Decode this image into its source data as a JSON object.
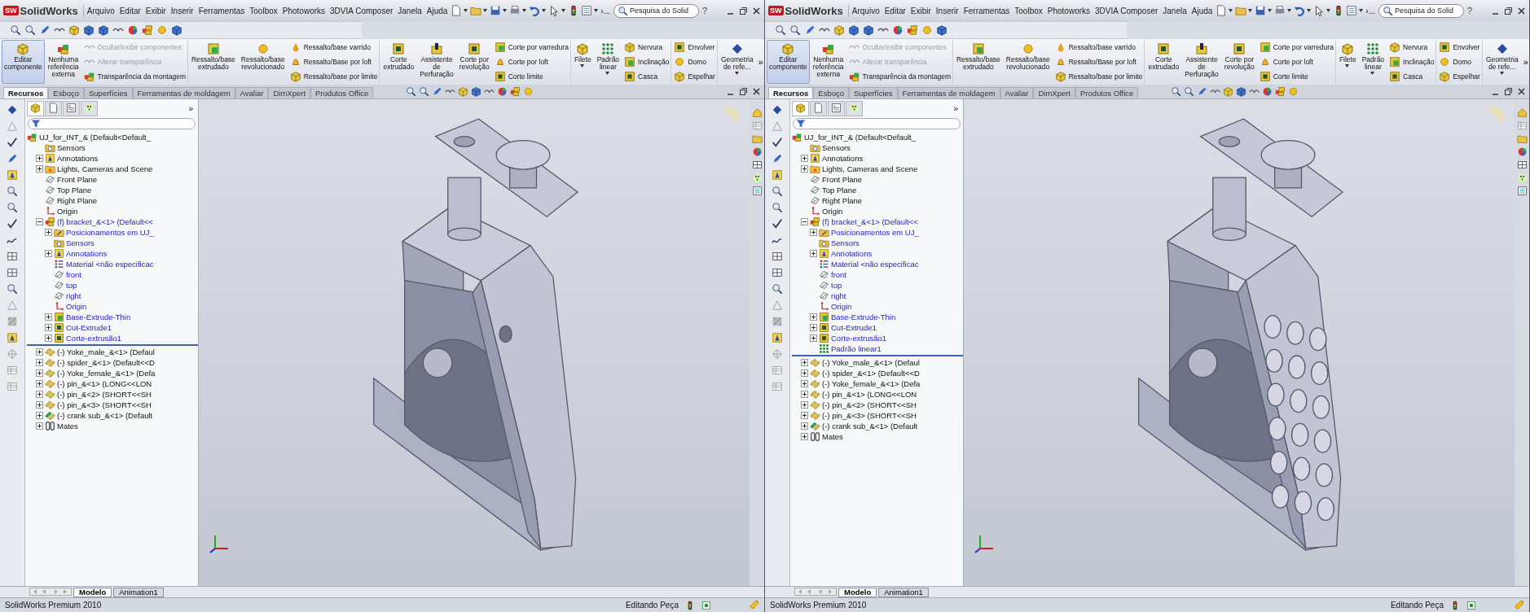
{
  "windows": [
    {
      "logo": {
        "badge": "SW",
        "text": "SolidWorks"
      },
      "menus": [
        "Arquivo",
        "Editar",
        "Exibir",
        "Inserir",
        "Ferramentas",
        "Toolbox",
        "Photoworks",
        "3DVIA Composer",
        "Janela",
        "Ajuda"
      ],
      "overflow": "›...",
      "search": {
        "placeholder": "Pesquisa do Solid"
      },
      "help": "?",
      "commands": [
        {
          "kind": "edit",
          "label": "Editar\ncomponente",
          "selected": true
        },
        {
          "kind": "noref",
          "label": "Nenhuma\nreferência\nexterna",
          "selected": false
        },
        {
          "kind": "stack",
          "items": [
            {
              "kind": "hide",
              "label": "Ocultar/exibir componentes",
              "disabled": true
            },
            {
              "kind": "transp",
              "label": "Alterar transparência",
              "disabled": true
            },
            {
              "kind": "asmtransp",
              "label": "Transparência da montagem",
              "disabled": false
            }
          ]
        },
        {
          "kind": "boss",
          "label": "Ressalto/base\nextrudado",
          "selected": false
        },
        {
          "kind": "revolve",
          "label": "Ressalto/base\nrevolucionado",
          "selected": false
        },
        {
          "kind": "stack",
          "items": [
            {
              "kind": "sweep",
              "label": "Ressalto/base varrido",
              "disabled": false
            },
            {
              "kind": "loft",
              "label": "Ressalto/Base por loft",
              "disabled": false
            },
            {
              "kind": "boundary",
              "label": "Ressalto/base por limite",
              "disabled": false
            }
          ]
        },
        {
          "kind": "cut",
          "label": "Corte\nextrudado",
          "selected": false
        },
        {
          "kind": "hole",
          "label": "Assistente\nde\nPerfuração",
          "selected": false
        },
        {
          "kind": "cutrev",
          "label": "Corte por\nrevolução",
          "selected": false
        },
        {
          "kind": "stack",
          "items": [
            {
              "kind": "cutsweep",
              "label": "Corte por varredura",
              "disabled": false
            },
            {
              "kind": "cutloft",
              "label": "Corte por loft",
              "disabled": false
            },
            {
              "kind": "cutbound",
              "label": "Corte limite",
              "disabled": false
            }
          ]
        },
        {
          "kind": "fillet",
          "label": "Filete",
          "selected": false,
          "dropdown": true
        },
        {
          "kind": "pattern",
          "label": "Padrão\nlinear",
          "selected": false,
          "dropdown": true
        },
        {
          "kind": "stack",
          "items": [
            {
              "kind": "rib",
              "label": "Nervura",
              "disabled": false
            },
            {
              "kind": "draft",
              "label": "Inclinação",
              "disabled": false
            },
            {
              "kind": "shell",
              "label": "Casca",
              "disabled": false
            }
          ]
        },
        {
          "kind": "stack",
          "items": [
            {
              "kind": "wrap",
              "label": "Envolver",
              "disabled": false
            },
            {
              "kind": "dome",
              "label": "Domo",
              "disabled": false
            },
            {
              "kind": "mirror",
              "label": "Espelhar",
              "disabled": false
            }
          ]
        },
        {
          "kind": "refgeom",
          "label": "Geometria\nde refe...",
          "selected": false,
          "dropdown": true
        },
        {
          "kind": "more",
          "label": "»"
        }
      ],
      "tabs": [
        {
          "label": "Recursos",
          "selected": true
        },
        {
          "label": "Esboço",
          "selected": false
        },
        {
          "label": "Superfícies",
          "selected": false
        },
        {
          "label": "Ferramentas de moldagem",
          "selected": false
        },
        {
          "label": "Avaliar",
          "selected": false
        },
        {
          "label": "DimXpert",
          "selected": false
        },
        {
          "label": "Produtos Office",
          "selected": false
        }
      ],
      "panel_more": "»",
      "panel_tabs": [
        {
          "kind": "features",
          "selected": true
        },
        {
          "kind": "properties",
          "selected": false
        },
        {
          "kind": "configurations",
          "selected": false
        },
        {
          "kind": "display",
          "selected": false
        }
      ],
      "tree": {
        "label": "UJ_for_INT_&  (Default<Default_",
        "kind": "assembly",
        "children": [
          {
            "label": "Sensors",
            "kind": "sensors",
            "editing": false
          },
          {
            "label": "Annotations",
            "kind": "annotations",
            "expanded": false,
            "editing": false
          },
          {
            "label": "Lights, Cameras and Scene",
            "kind": "lights",
            "expanded": false,
            "editing": false
          },
          {
            "label": "Front Plane",
            "kind": "plane",
            "editing": false
          },
          {
            "label": "Top Plane",
            "kind": "plane",
            "editing": false
          },
          {
            "label": "Right Plane",
            "kind": "plane",
            "editing": false
          },
          {
            "label": "Origin",
            "kind": "origin",
            "editing": false
          },
          {
            "label": "(f) bracket_&<1> (Default<<",
            "kind": "part",
            "expanded": true,
            "editing": true,
            "children": [
              {
                "label": "Posicionamentos em UJ_",
                "kind": "positions",
                "expanded": false
              },
              {
                "label": "Sensors",
                "kind": "sensors"
              },
              {
                "label": "Annotations",
                "kind": "annotations",
                "expanded": false
              },
              {
                "label": "Material <não especificac",
                "kind": "material"
              },
              {
                "label": "front",
                "kind": "plane"
              },
              {
                "label": "top",
                "kind": "plane"
              },
              {
                "label": "right",
                "kind": "plane"
              },
              {
                "label": "Origin",
                "kind": "origin"
              },
              {
                "label": "Base-Extrude-Thin",
                "kind": "extrude",
                "expanded": false
              },
              {
                "label": "Cut-Extrude1",
                "kind": "cut",
                "expanded": false
              },
              {
                "label": "Corte-extrusão1",
                "kind": "cut",
                "expanded": false
              }
            ]
          },
          {
            "label": "(-) Yoke_male_&<1> (Defaul",
            "kind": "component",
            "expanded": false,
            "editing": false
          },
          {
            "label": "(-) spider_&<1> (Default<<D",
            "kind": "component",
            "expanded": false,
            "editing": false
          },
          {
            "label": "(-) Yoke_female_&<1> (Defa",
            "kind": "component",
            "expanded": false,
            "editing": false
          },
          {
            "label": "(-) pin_&<1> (LONG<<LON",
            "kind": "component",
            "expanded": false,
            "editing": false
          },
          {
            "label": "(-) pin_&<2> (SHORT<<SH",
            "kind": "component",
            "expanded": false,
            "editing": false
          },
          {
            "label": "(-) pin_&<3> (SHORT<<SH",
            "kind": "component",
            "expanded": false,
            "editing": false
          },
          {
            "label": "(-) crank sub_&<1> (Default",
            "kind": "subassembly",
            "expanded": false,
            "editing": false
          },
          {
            "label": "Mates",
            "kind": "mates",
            "expanded": false,
            "editing": false
          }
        ]
      },
      "model": {
        "kind": "bracket"
      },
      "bottom_tabs": [
        {
          "label": "Modelo",
          "selected": true
        },
        {
          "label": "Animation1",
          "selected": false
        }
      ],
      "status": {
        "product": "SolidWorks Premium 2010",
        "mode": "Editando Peça"
      }
    },
    {
      "logo": {
        "badge": "SW",
        "text": "SolidWorks"
      },
      "menus": [
        "Arquivo",
        "Editar",
        "Exibir",
        "Inserir",
        "Ferramentas",
        "Toolbox",
        "Photoworks",
        "3DVIA Composer",
        "Janela",
        "Ajuda"
      ],
      "overflow": "›...",
      "search": {
        "placeholder": "Pesquisa do Solid"
      },
      "help": "?",
      "commands": [
        {
          "kind": "edit",
          "label": "Editar\ncomponente",
          "selected": true
        },
        {
          "kind": "noref",
          "label": "Nenhuma\nreferência\nexterna",
          "selected": false
        },
        {
          "kind": "stack",
          "items": [
            {
              "kind": "hide",
              "label": "Ocultar/exibir componentes",
              "disabled": true
            },
            {
              "kind": "transp",
              "label": "Alterar transparência",
              "disabled": true
            },
            {
              "kind": "asmtransp",
              "label": "Transparência da montagem",
              "disabled": false
            }
          ]
        },
        {
          "kind": "boss",
          "label": "Ressalto/base\nextrudado",
          "selected": false
        },
        {
          "kind": "revolve",
          "label": "Ressalto/base\nrevolucionado",
          "selected": false
        },
        {
          "kind": "stack",
          "items": [
            {
              "kind": "sweep",
              "label": "Ressalto/base varrido",
              "disabled": false
            },
            {
              "kind": "loft",
              "label": "Ressalto/Base por loft",
              "disabled": false
            },
            {
              "kind": "boundary",
              "label": "Ressalto/base por limite",
              "disabled": false
            }
          ]
        },
        {
          "kind": "cut",
          "label": "Corte\nextrudado",
          "selected": false
        },
        {
          "kind": "hole",
          "label": "Assistente\nde\nPerfuração",
          "selected": false
        },
        {
          "kind": "cutrev",
          "label": "Corte por\nrevolução",
          "selected": false
        },
        {
          "kind": "stack",
          "items": [
            {
              "kind": "cutsweep",
              "label": "Corte por varredura",
              "disabled": false
            },
            {
              "kind": "cutloft",
              "label": "Corte por loft",
              "disabled": false
            },
            {
              "kind": "cutbound",
              "label": "Corte limite",
              "disabled": false
            }
          ]
        },
        {
          "kind": "fillet",
          "label": "Filete",
          "selected": false,
          "dropdown": true
        },
        {
          "kind": "pattern",
          "label": "Padrão\nlinear",
          "selected": false,
          "dropdown": true
        },
        {
          "kind": "stack",
          "items": [
            {
              "kind": "rib",
              "label": "Nervura",
              "disabled": false
            },
            {
              "kind": "draft",
              "label": "Inclinação",
              "disabled": false
            },
            {
              "kind": "shell",
              "label": "Casca",
              "disabled": false
            }
          ]
        },
        {
          "kind": "stack",
          "items": [
            {
              "kind": "wrap",
              "label": "Envolver",
              "disabled": false
            },
            {
              "kind": "dome",
              "label": "Domo",
              "disabled": false
            },
            {
              "kind": "mirror",
              "label": "Espelhar",
              "disabled": false
            }
          ]
        },
        {
          "kind": "refgeom",
          "label": "Geometria\nde refe...",
          "selected": false,
          "dropdown": true
        },
        {
          "kind": "more",
          "label": "»"
        }
      ],
      "tabs": [
        {
          "label": "Recursos",
          "selected": true
        },
        {
          "label": "Esboço",
          "selected": false
        },
        {
          "label": "Superfícies",
          "selected": false
        },
        {
          "label": "Ferramentas de moldagem",
          "selected": false
        },
        {
          "label": "Avaliar",
          "selected": false
        },
        {
          "label": "DimXpert",
          "selected": false
        },
        {
          "label": "Produtos Office",
          "selected": false
        }
      ],
      "panel_more": "»",
      "panel_tabs": [
        {
          "kind": "features",
          "selected": true
        },
        {
          "kind": "properties",
          "selected": false
        },
        {
          "kind": "configurations",
          "selected": false
        },
        {
          "kind": "display",
          "selected": false
        }
      ],
      "tree": {
        "label": "UJ_for_INT_&  (Default<Default_",
        "kind": "assembly",
        "children": [
          {
            "label": "Sensors",
            "kind": "sensors",
            "editing": false
          },
          {
            "label": "Annotations",
            "kind": "annotations",
            "expanded": false,
            "editing": false
          },
          {
            "label": "Lights, Cameras and Scene",
            "kind": "lights",
            "expanded": false,
            "editing": false
          },
          {
            "label": "Front Plane",
            "kind": "plane",
            "editing": false
          },
          {
            "label": "Top Plane",
            "kind": "plane",
            "editing": false
          },
          {
            "label": "Right Plane",
            "kind": "plane",
            "editing": false
          },
          {
            "label": "Origin",
            "kind": "origin",
            "editing": false
          },
          {
            "label": "(f) bracket_&<1> (Default<<",
            "kind": "part",
            "expanded": true,
            "editing": true,
            "children": [
              {
                "label": "Posicionamentos em UJ_",
                "kind": "positions",
                "expanded": false
              },
              {
                "label": "Sensors",
                "kind": "sensors"
              },
              {
                "label": "Annotations",
                "kind": "annotations",
                "expanded": false
              },
              {
                "label": "Material <não especificac",
                "kind": "material"
              },
              {
                "label": "front",
                "kind": "plane"
              },
              {
                "label": "top",
                "kind": "plane"
              },
              {
                "label": "right",
                "kind": "plane"
              },
              {
                "label": "Origin",
                "kind": "origin"
              },
              {
                "label": "Base-Extrude-Thin",
                "kind": "extrude",
                "expanded": false
              },
              {
                "label": "Cut-Extrude1",
                "kind": "cut",
                "expanded": false
              },
              {
                "label": "Corte-extrusão1",
                "kind": "cut",
                "expanded": false
              },
              {
                "label": "Padrão linear1",
                "kind": "pattern"
              }
            ]
          },
          {
            "label": "(-) Yoke_male_&<1> (Defaul",
            "kind": "component",
            "expanded": false,
            "editing": false
          },
          {
            "label": "(-) spider_&<1> (Default<<D",
            "kind": "component",
            "expanded": false,
            "editing": false
          },
          {
            "label": "(-) Yoke_female_&<1> (Defa",
            "kind": "component",
            "expanded": false,
            "editing": false
          },
          {
            "label": "(-) pin_&<1> (LONG<<LON",
            "kind": "component",
            "expanded": false,
            "editing": false
          },
          {
            "label": "(-) pin_&<2> (SHORT<<SH",
            "kind": "component",
            "expanded": false,
            "editing": false
          },
          {
            "label": "(-) pin_&<3> (SHORT<<SH",
            "kind": "component",
            "expanded": false,
            "editing": false
          },
          {
            "label": "(-) crank sub_&<1> (Default",
            "kind": "subassembly",
            "expanded": false,
            "editing": false
          },
          {
            "label": "Mates",
            "kind": "mates",
            "expanded": false,
            "editing": false
          }
        ]
      },
      "model": {
        "kind": "bracket-perforated"
      },
      "bottom_tabs": [
        {
          "label": "Modelo",
          "selected": true
        },
        {
          "label": "Animation1",
          "selected": false
        }
      ],
      "status": {
        "product": "SolidWorks Premium 2010",
        "mode": "Editando Peça"
      }
    }
  ]
}
